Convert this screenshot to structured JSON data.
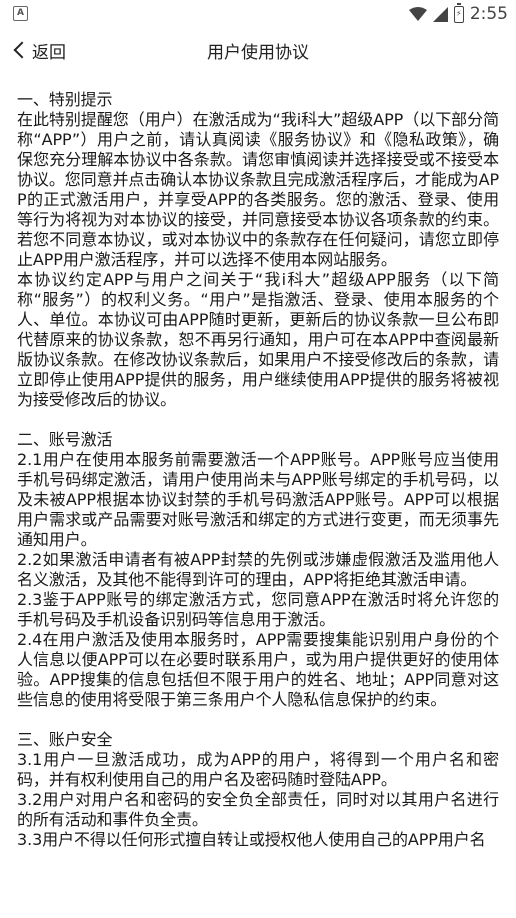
{
  "statusbar": {
    "left_icon_text": "A",
    "battery_text": "⚡",
    "time": "2:55"
  },
  "navbar": {
    "back_label": "返回",
    "title": "用户使用协议"
  },
  "sections": [
    {
      "title": "一、特别提示",
      "paragraphs": [
        "在此特别提醒您（用户）在激活成为“我i科大”超级APP（以下部分简称“APP”）用户之前，请认真阅读《服务协议》和《隐私政策》，确保您充分理解本协议中各条款。请您审慎阅读并选择接受或不接受本协议。您同意并点击确认本协议条款且完成激活程序后，才能成为APP的正式激活用户，并享受APP的各类服务。您的激活、登录、使用等行为将视为对本协议的接受，并同意接受本协议各项条款的约束。若您不同意本协议，或对本协议中的条款存在任何疑问，请您立即停止APP用户激活程序，并可以选择不使用本网站服务。",
        "本协议约定APP与用户之间关于“我i科大”超级APP服务（以下简称“服务”）的权利义务。“用户”是指激活、登录、使用本服务的个人、单位。本协议可由APP随时更新，更新后的协议条款一旦公布即代替原来的协议条款，恕不再另行通知，用户可在本APP中查阅最新版协议条款。在修改协议条款后，如果用户不接受修改后的条款，请立即停止使用APP提供的服务，用户继续使用APP提供的服务将被视为接受修改后的协议。"
      ]
    },
    {
      "title": "二、账号激活",
      "paragraphs": [
        "2.1用户在使用本服务前需要激活一个APP账号。APP账号应当使用手机号码绑定激活，请用户使用尚未与APP账号绑定的手机号码，以及未被APP根据本协议封禁的手机号码激活APP账号。APP可以根据用户需求或产品需要对账号激活和绑定的方式进行变更，而无须事先通知用户。",
        "2.2如果激活申请者有被APP封禁的先例或涉嫌虚假激活及滥用他人名义激活，及其他不能得到许可的理由，APP将拒绝其激活申请。",
        "2.3鉴于APP账号的绑定激活方式，您同意APP在激活时将允许您的手机号码及手机设备识别码等信息用于激活。",
        "2.4在用户激活及使用本服务时，APP需要搜集能识别用户身份的个人信息以便APP可以在必要时联系用户，或为用户提供更好的使用体验。APP搜集的信息包括但不限于用户的姓名、地址；APP同意对这些信息的使用将受限于第三条用户个人隐私信息保护的约束。"
      ]
    },
    {
      "title": "三、账户安全",
      "paragraphs": [
        "3.1用户一旦激活成功，成为APP的用户，将得到一个用户名和密码，并有权利使用自己的用户名及密码随时登陆APP。",
        "3.2用户对用户名和密码的安全负全部责任，同时对以其用户名进行的所有活动和事件负全责。",
        "3.3用户不得以任何形式擅自转让或授权他人使用自己的APP用户名"
      ]
    }
  ]
}
